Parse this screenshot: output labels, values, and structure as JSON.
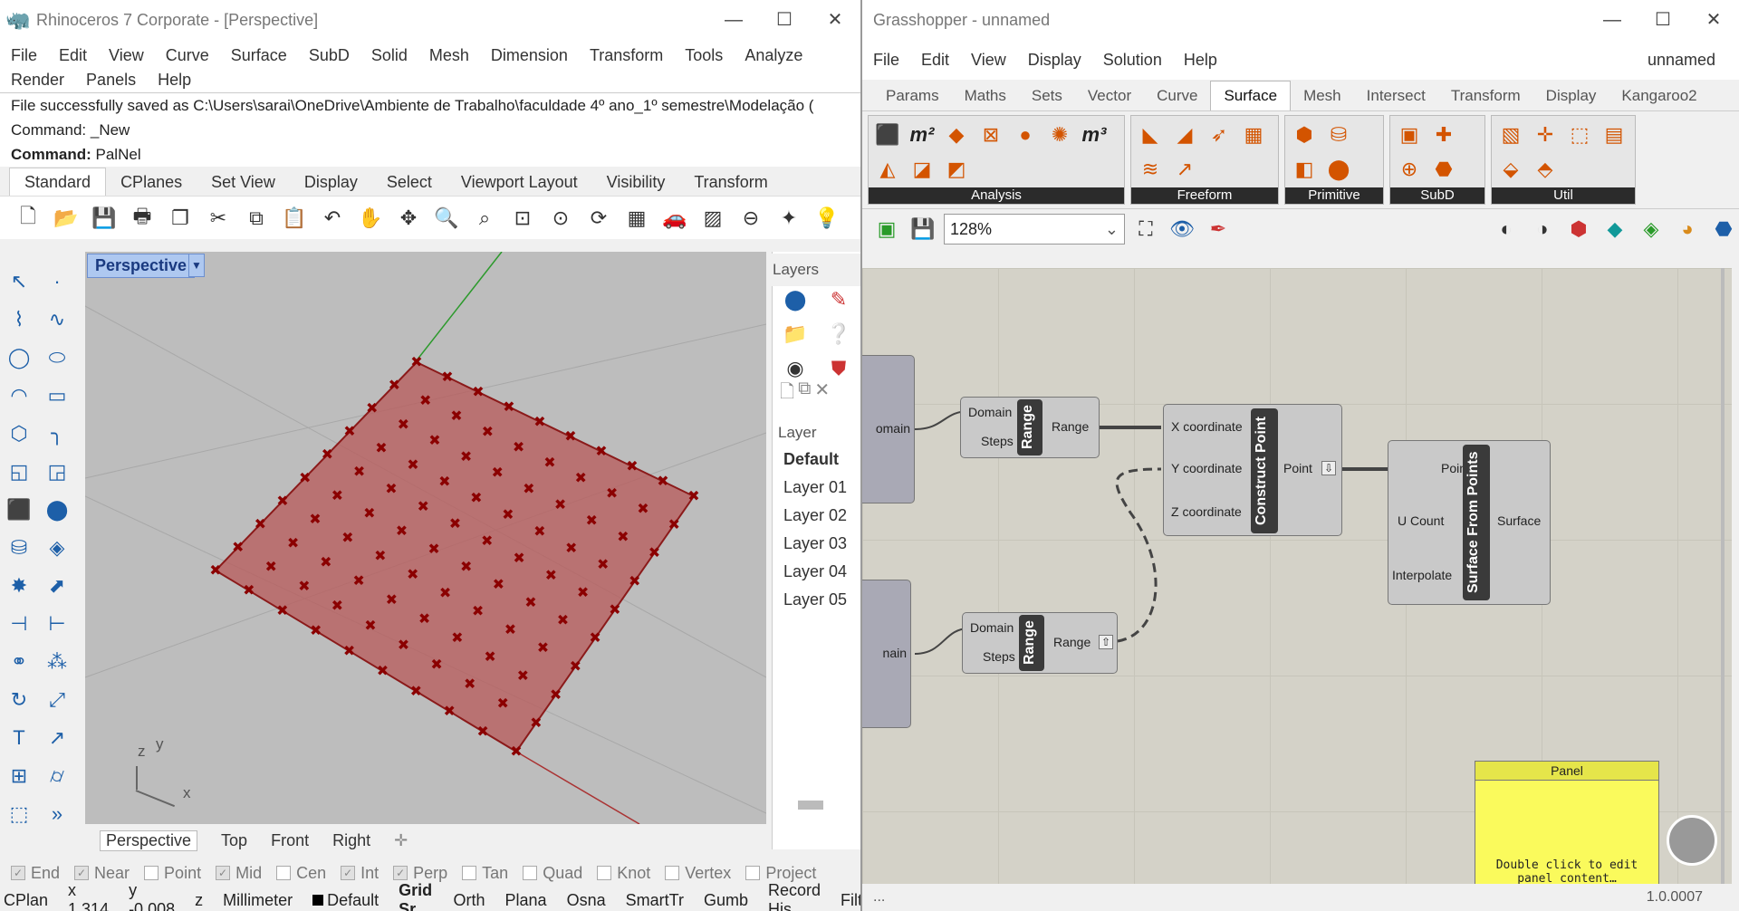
{
  "rhino": {
    "title": "Rhinoceros 7 Corporate - [Perspective]",
    "menu": [
      "File",
      "Edit",
      "View",
      "Curve",
      "Surface",
      "SubD",
      "Solid",
      "Mesh",
      "Dimension",
      "Transform",
      "Tools",
      "Analyze",
      "Render",
      "Panels",
      "Help"
    ],
    "cmd_history": [
      "File successfully saved as C:\\Users\\sarai\\OneDrive\\Ambiente de Trabalho\\faculdade 4º ano_1º semestre\\Modelação (",
      "Command: _New"
    ],
    "cmd_prompt": "Command:",
    "cmd_value": "PalNel",
    "tabs": [
      "Standard",
      "CPlanes",
      "Set View",
      "Display",
      "Select",
      "Viewport Layout",
      "Visibility",
      "Transform"
    ],
    "viewport_label": "Perspective",
    "axes": {
      "z": "z",
      "y": "y",
      "x": "x"
    },
    "viewport_tabs": [
      "Perspective",
      "Top",
      "Front",
      "Right"
    ],
    "layers": {
      "title": "Layers",
      "header": "Layer",
      "items": [
        "Default",
        "Layer 01",
        "Layer 02",
        "Layer 03",
        "Layer 04",
        "Layer 05"
      ]
    },
    "osnaps": [
      {
        "label": "End",
        "on": true
      },
      {
        "label": "Near",
        "on": true
      },
      {
        "label": "Point",
        "on": false
      },
      {
        "label": "Mid",
        "on": true
      },
      {
        "label": "Cen",
        "on": false
      },
      {
        "label": "Int",
        "on": true
      },
      {
        "label": "Perp",
        "on": true
      },
      {
        "label": "Tan",
        "on": false
      },
      {
        "label": "Quad",
        "on": false
      },
      {
        "label": "Knot",
        "on": false
      },
      {
        "label": "Vertex",
        "on": false
      },
      {
        "label": "Project",
        "on": false
      }
    ],
    "status": {
      "cplane": "CPlan",
      "x": "x 1.314",
      "y": "y -0.008",
      "z": "z",
      "units": "Millimeter",
      "layer": "Default",
      "items": [
        "Grid Sr",
        "Orth",
        "Plana",
        "Osna",
        "SmartTr",
        "Gumb",
        "Record His",
        "Filt"
      ]
    }
  },
  "gh": {
    "title": "Grasshopper - unnamed",
    "menu": [
      "File",
      "Edit",
      "View",
      "Display",
      "Solution",
      "Help"
    ],
    "doc_name": "unnamed",
    "tabs": [
      "Params",
      "Maths",
      "Sets",
      "Vector",
      "Curve",
      "Surface",
      "Mesh",
      "Intersect",
      "Transform",
      "Display",
      "Kangaroo2"
    ],
    "active_tab": "Surface",
    "ribbon_groups": [
      "Analysis",
      "Freeform",
      "Primitive",
      "SubD",
      "Util"
    ],
    "zoom": "128%",
    "components": {
      "range1": {
        "name": "Range",
        "inputs": [
          "Domain",
          "Steps"
        ],
        "output": "Range"
      },
      "range2": {
        "name": "Range",
        "inputs": [
          "Domain",
          "Steps"
        ],
        "output": "Range"
      },
      "construct_point": {
        "name": "Construct Point",
        "inputs": [
          "X coordinate",
          "Y coordinate",
          "Z coordinate"
        ],
        "output": "Point"
      },
      "surface_from_points": {
        "name": "Surface From Points",
        "inputs": [
          "Points",
          "U Count",
          "Interpolate"
        ],
        "output": "Surface"
      },
      "domain_label_1": "omain",
      "domain_label_2": "nain",
      "panel": {
        "title": "Panel",
        "text": "Double click to edit panel content…"
      }
    },
    "status_left": "...",
    "version": "1.0.0007"
  }
}
